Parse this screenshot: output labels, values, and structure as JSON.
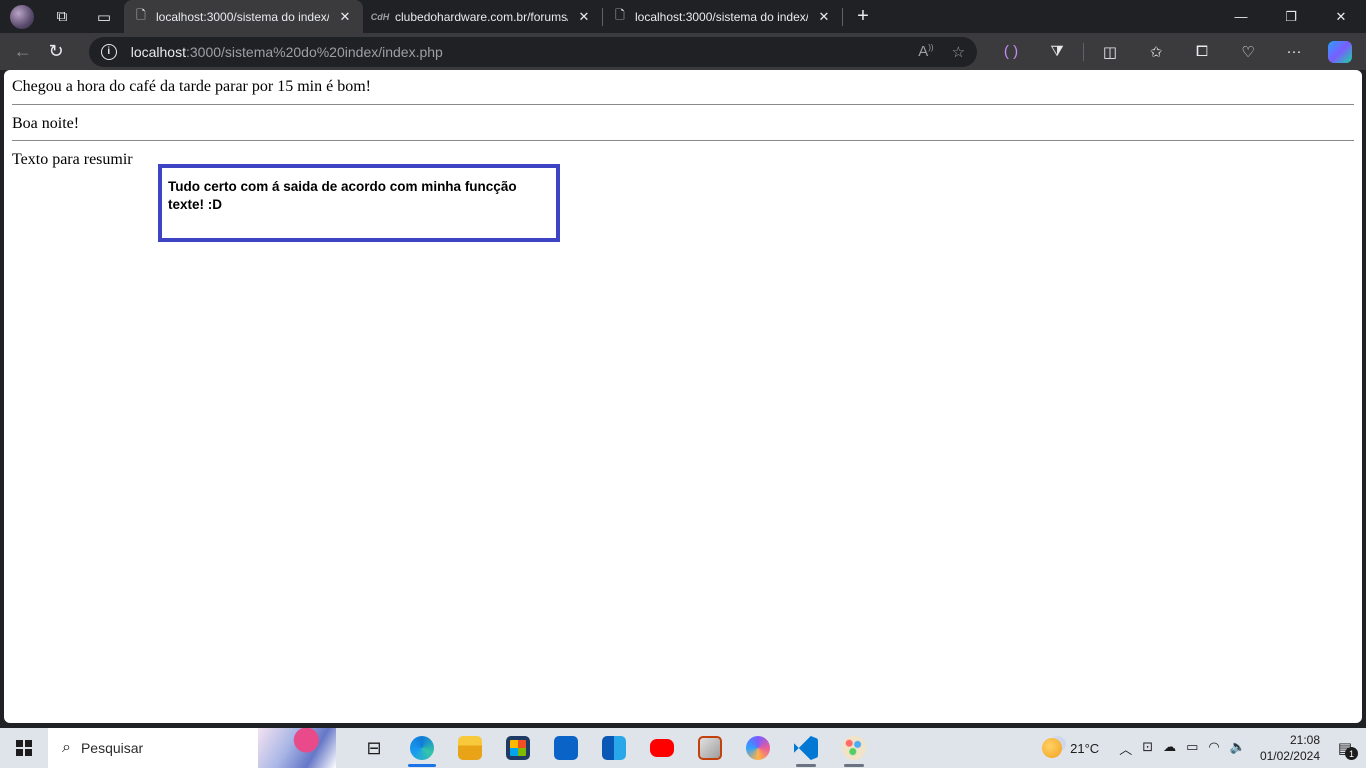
{
  "tabs": [
    {
      "title": "localhost:3000/sistema do index/",
      "active": true
    },
    {
      "title": "clubedohardware.com.br/forums/",
      "active": false
    },
    {
      "title": "localhost:3000/sistema do index/",
      "active": false
    }
  ],
  "address": {
    "host": "localhost",
    "path": ":3000/sistema%20do%20index/index.php"
  },
  "page": {
    "line1": "Chegou a hora do café da tarde parar por 15 min é bom!",
    "line2": "Boa noite!",
    "line3": "Texto para resumir",
    "box_text": "Tudo certo com á saida de acordo com minha funcção texte! :D"
  },
  "taskbar": {
    "search_placeholder": "Pesquisar",
    "weather_temp": "21°C",
    "time": "21:08",
    "date": "01/02/2024",
    "notification_count": "1"
  },
  "colors": {
    "box_border": "#3f44c5",
    "tabstrip_bg": "#202124",
    "toolbar_bg": "#3b3b3d",
    "taskbar_bg": "#dfe3ea"
  }
}
